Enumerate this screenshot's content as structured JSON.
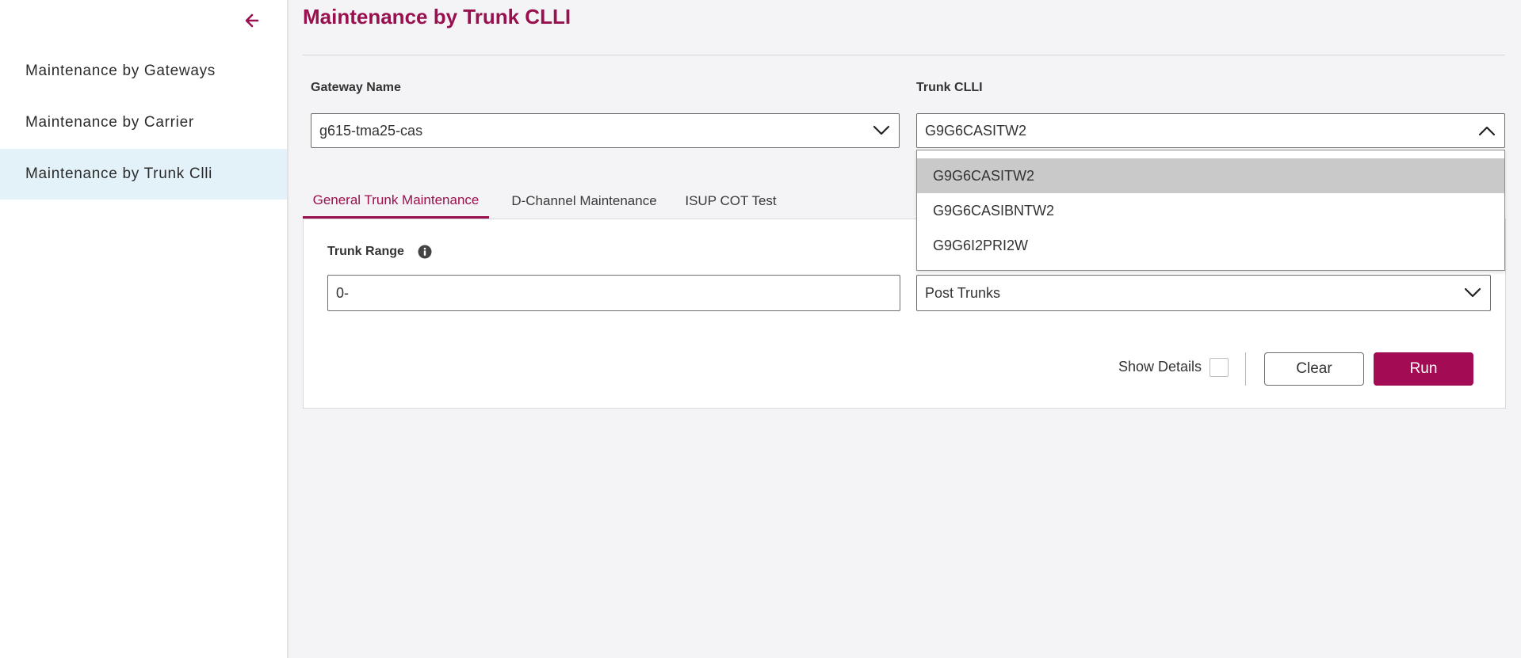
{
  "sidebar": {
    "back_icon": "arrow-left-icon",
    "items": [
      {
        "label": "Maintenance by Gateways",
        "active": false
      },
      {
        "label": "Maintenance by Carrier",
        "active": false
      },
      {
        "label": "Maintenance by Trunk Clli",
        "active": true
      }
    ]
  },
  "page": {
    "title": "Maintenance by Trunk CLLI"
  },
  "gateway": {
    "label": "Gateway Name",
    "value": "g615-tma25-cas",
    "icon": "chevron-down-icon"
  },
  "trunk_clli": {
    "label": "Trunk CLLI",
    "value": "G9G6CASITW2",
    "icon": "chevron-up-icon",
    "options": [
      "G9G6CASITW2",
      "G9G6CASIBNTW2",
      "G9G6I2PRI2W"
    ],
    "selected_index": 0
  },
  "tabs": [
    {
      "label": "General Trunk Maintenance",
      "active": true
    },
    {
      "label": "D-Channel Maintenance",
      "active": false
    },
    {
      "label": "ISUP COT Test",
      "active": false
    }
  ],
  "panel": {
    "trunk_range_label": "Trunk Range",
    "trunk_range_icon": "info-icon",
    "trunk_range_value": "0-",
    "action_value": "Post Trunks",
    "show_details_label": "Show Details",
    "show_details_checked": false,
    "clear_label": "Clear",
    "run_label": "Run"
  },
  "colors": {
    "accent": "#99104f",
    "run_button": "#a30b55",
    "active_nav_bg": "#e3f1f8"
  }
}
